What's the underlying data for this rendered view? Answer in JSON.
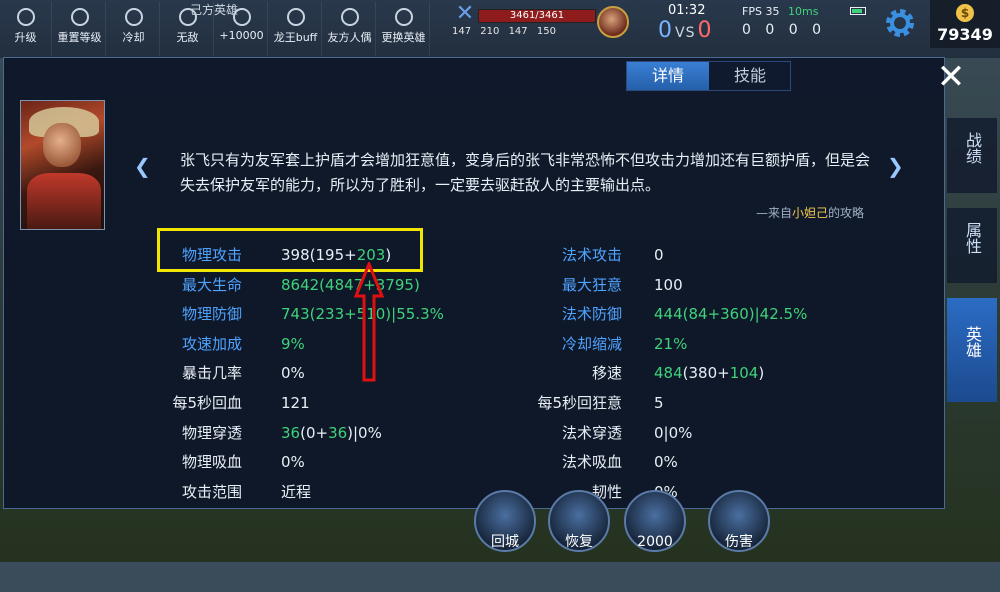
{
  "top": {
    "cheat_title": "己方英雄",
    "cheat_buttons": [
      {
        "label": "升级",
        "icon": "upgrade-icon"
      },
      {
        "label": "重置等级",
        "icon": "reset-icon"
      },
      {
        "label": "冷却",
        "icon": "cooldown-icon"
      },
      {
        "label": "无敌",
        "icon": "invincible-icon"
      },
      {
        "label": "+10000",
        "icon": "gold-coin-icon"
      },
      {
        "label": "龙王buff",
        "icon": "dragon-icon"
      },
      {
        "label": "友方人偶",
        "icon": "dummy-icon"
      },
      {
        "label": "更换英雄",
        "icon": "swap-icon"
      }
    ],
    "hp": "3461/3461",
    "hero_stats": [
      "147",
      "210",
      "147",
      "150"
    ],
    "clock": "01:32",
    "score_blue": "0",
    "score_vs": "VS",
    "score_red": "0",
    "fps": "FPS 35",
    "ping": "10ms",
    "kda": [
      "0",
      "0",
      "0",
      "0"
    ],
    "gold": "79349"
  },
  "panel": {
    "tabs": [
      "详情",
      "技能"
    ],
    "active_tab": "详情",
    "description": "张飞只有为友军套上护盾才会增加狂意值，变身后的张飞非常恐怖不但攻击力增加还有巨额护盾，但是会失去保护友军的能力，所以为了胜利，一定要去驱赶敌人的主要输出点。",
    "source_prefix": "—来自",
    "source_author": "小妲己",
    "source_suffix": "的攻略",
    "left_stats": [
      {
        "label": "物理攻击",
        "color": "blue",
        "v1": "398(195+",
        "v2": "203",
        "v3": ")",
        "mode": "mixed"
      },
      {
        "label": "最大生命",
        "color": "blue",
        "v1": "8642(4847+3795)",
        "mode": "green"
      },
      {
        "label": "物理防御",
        "color": "blue",
        "v1": "743(233+510)|55.3%",
        "mode": "green"
      },
      {
        "label": "攻速加成",
        "color": "blue",
        "v1": "9%",
        "mode": "green"
      },
      {
        "label": "暴击几率",
        "color": "white",
        "v1": "0%",
        "mode": "white"
      },
      {
        "label": "每5秒回血",
        "color": "white",
        "v1": "121",
        "mode": "white"
      },
      {
        "label": "物理穿透",
        "color": "white",
        "v1": "36",
        "v2": "(0+",
        "v3": "36",
        "v4": ")|0%",
        "mode": "mixed2"
      },
      {
        "label": "物理吸血",
        "color": "white",
        "v1": "0%",
        "mode": "white"
      },
      {
        "label": "攻击范围",
        "color": "white",
        "v1": "近程",
        "mode": "white"
      }
    ],
    "right_stats": [
      {
        "label": "法术攻击",
        "color": "blue",
        "v1": "0",
        "mode": "white"
      },
      {
        "label": "最大狂意",
        "color": "blue",
        "v1": "100",
        "mode": "white"
      },
      {
        "label": "法术防御",
        "color": "blue",
        "v1": "444(84+360)|42.5%",
        "mode": "green"
      },
      {
        "label": "冷却缩减",
        "color": "blue",
        "v1": "21%",
        "mode": "green"
      },
      {
        "label": "移速",
        "color": "white",
        "v1": "484",
        "v2": "(380+",
        "v3": "104",
        "v4": ")",
        "mode": "mixed2"
      },
      {
        "label": "每5秒回狂意",
        "color": "white",
        "v1": "5",
        "mode": "white"
      },
      {
        "label": "法术穿透",
        "color": "white",
        "v1": "0|0%",
        "mode": "white"
      },
      {
        "label": "法术吸血",
        "color": "white",
        "v1": "0%",
        "mode": "white"
      },
      {
        "label": "韧性",
        "color": "white",
        "v1": "0%",
        "mode": "white"
      }
    ]
  },
  "side_tabs": [
    "战绩",
    "属性",
    "英雄"
  ],
  "active_side_tab": "英雄",
  "skills": [
    "回城",
    "恢复",
    "2000",
    "伤害"
  ],
  "colors": {
    "blue_label": "#4ea3ff",
    "green_value": "#3fd27a",
    "highlight": "#f0e600",
    "arrow": "#e01010"
  }
}
